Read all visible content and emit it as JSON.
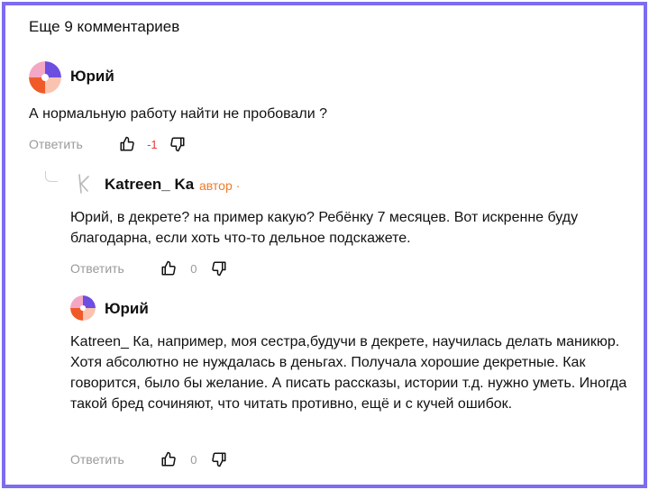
{
  "more_comments_label": "Еще 9 комментариев",
  "comments": [
    {
      "author": "Юрий",
      "text": "А нормальную работу найти не пробовали ?",
      "reply_label": "Ответить",
      "score": "-1"
    },
    {
      "author": "Katreen_ Ka",
      "badge": "автор ·",
      "text": "Юрий, в декрете? на пример какую? Ребёнку 7 месяцев. Вот искренне буду благодарна, если хоть что-то дельное подскажете.",
      "reply_label": "Ответить",
      "score": "0"
    },
    {
      "author": "Юрий",
      "text": "Katreen_ Ка, например, моя сестра,будучи в декрете, научилась делать маникюр. Хотя абсолютно не нуждалась в деньгах. Получала хорошие декретные. Как говорится, было бы желание. А писать рассказы, истории т.д. нужно уметь. Иногда такой бред сочиняют, что читать противно, ещё и с кучей ошибок.",
      "reply_label": "Ответить",
      "score": "0"
    }
  ],
  "colors": {
    "frame": "#7b6cf0",
    "badge": "#f07a2a",
    "negative_score": "#e53935",
    "muted": "#9a9a9a"
  }
}
